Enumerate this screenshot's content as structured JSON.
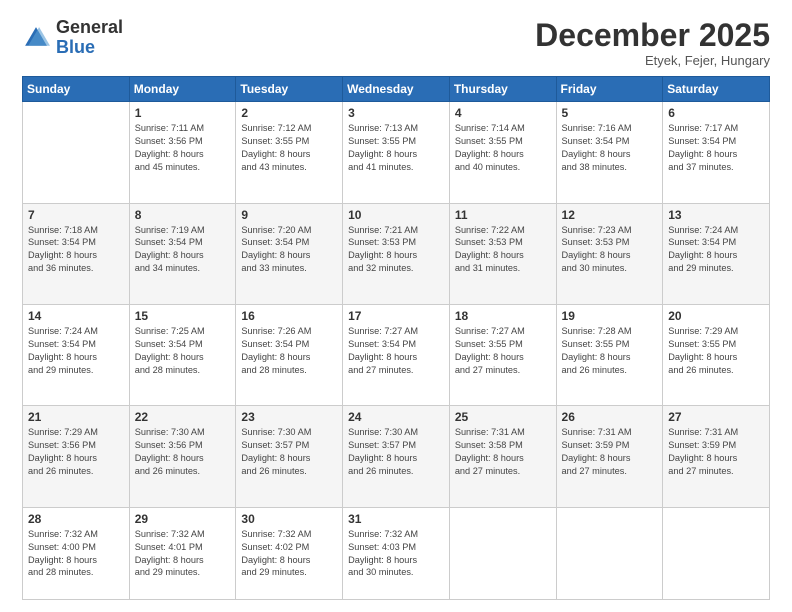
{
  "header": {
    "logo_line1": "General",
    "logo_line2": "Blue",
    "month": "December 2025",
    "location": "Etyek, Fejer, Hungary"
  },
  "days_of_week": [
    "Sunday",
    "Monday",
    "Tuesday",
    "Wednesday",
    "Thursday",
    "Friday",
    "Saturday"
  ],
  "weeks": [
    [
      {
        "day": "",
        "content": ""
      },
      {
        "day": "1",
        "content": "Sunrise: 7:11 AM\nSunset: 3:56 PM\nDaylight: 8 hours\nand 45 minutes."
      },
      {
        "day": "2",
        "content": "Sunrise: 7:12 AM\nSunset: 3:55 PM\nDaylight: 8 hours\nand 43 minutes."
      },
      {
        "day": "3",
        "content": "Sunrise: 7:13 AM\nSunset: 3:55 PM\nDaylight: 8 hours\nand 41 minutes."
      },
      {
        "day": "4",
        "content": "Sunrise: 7:14 AM\nSunset: 3:55 PM\nDaylight: 8 hours\nand 40 minutes."
      },
      {
        "day": "5",
        "content": "Sunrise: 7:16 AM\nSunset: 3:54 PM\nDaylight: 8 hours\nand 38 minutes."
      },
      {
        "day": "6",
        "content": "Sunrise: 7:17 AM\nSunset: 3:54 PM\nDaylight: 8 hours\nand 37 minutes."
      }
    ],
    [
      {
        "day": "7",
        "content": "Sunrise: 7:18 AM\nSunset: 3:54 PM\nDaylight: 8 hours\nand 36 minutes."
      },
      {
        "day": "8",
        "content": "Sunrise: 7:19 AM\nSunset: 3:54 PM\nDaylight: 8 hours\nand 34 minutes."
      },
      {
        "day": "9",
        "content": "Sunrise: 7:20 AM\nSunset: 3:54 PM\nDaylight: 8 hours\nand 33 minutes."
      },
      {
        "day": "10",
        "content": "Sunrise: 7:21 AM\nSunset: 3:53 PM\nDaylight: 8 hours\nand 32 minutes."
      },
      {
        "day": "11",
        "content": "Sunrise: 7:22 AM\nSunset: 3:53 PM\nDaylight: 8 hours\nand 31 minutes."
      },
      {
        "day": "12",
        "content": "Sunrise: 7:23 AM\nSunset: 3:53 PM\nDaylight: 8 hours\nand 30 minutes."
      },
      {
        "day": "13",
        "content": "Sunrise: 7:24 AM\nSunset: 3:54 PM\nDaylight: 8 hours\nand 29 minutes."
      }
    ],
    [
      {
        "day": "14",
        "content": "Sunrise: 7:24 AM\nSunset: 3:54 PM\nDaylight: 8 hours\nand 29 minutes."
      },
      {
        "day": "15",
        "content": "Sunrise: 7:25 AM\nSunset: 3:54 PM\nDaylight: 8 hours\nand 28 minutes."
      },
      {
        "day": "16",
        "content": "Sunrise: 7:26 AM\nSunset: 3:54 PM\nDaylight: 8 hours\nand 28 minutes."
      },
      {
        "day": "17",
        "content": "Sunrise: 7:27 AM\nSunset: 3:54 PM\nDaylight: 8 hours\nand 27 minutes."
      },
      {
        "day": "18",
        "content": "Sunrise: 7:27 AM\nSunset: 3:55 PM\nDaylight: 8 hours\nand 27 minutes."
      },
      {
        "day": "19",
        "content": "Sunrise: 7:28 AM\nSunset: 3:55 PM\nDaylight: 8 hours\nand 26 minutes."
      },
      {
        "day": "20",
        "content": "Sunrise: 7:29 AM\nSunset: 3:55 PM\nDaylight: 8 hours\nand 26 minutes."
      }
    ],
    [
      {
        "day": "21",
        "content": "Sunrise: 7:29 AM\nSunset: 3:56 PM\nDaylight: 8 hours\nand 26 minutes."
      },
      {
        "day": "22",
        "content": "Sunrise: 7:30 AM\nSunset: 3:56 PM\nDaylight: 8 hours\nand 26 minutes."
      },
      {
        "day": "23",
        "content": "Sunrise: 7:30 AM\nSunset: 3:57 PM\nDaylight: 8 hours\nand 26 minutes."
      },
      {
        "day": "24",
        "content": "Sunrise: 7:30 AM\nSunset: 3:57 PM\nDaylight: 8 hours\nand 26 minutes."
      },
      {
        "day": "25",
        "content": "Sunrise: 7:31 AM\nSunset: 3:58 PM\nDaylight: 8 hours\nand 27 minutes."
      },
      {
        "day": "26",
        "content": "Sunrise: 7:31 AM\nSunset: 3:59 PM\nDaylight: 8 hours\nand 27 minutes."
      },
      {
        "day": "27",
        "content": "Sunrise: 7:31 AM\nSunset: 3:59 PM\nDaylight: 8 hours\nand 27 minutes."
      }
    ],
    [
      {
        "day": "28",
        "content": "Sunrise: 7:32 AM\nSunset: 4:00 PM\nDaylight: 8 hours\nand 28 minutes."
      },
      {
        "day": "29",
        "content": "Sunrise: 7:32 AM\nSunset: 4:01 PM\nDaylight: 8 hours\nand 29 minutes."
      },
      {
        "day": "30",
        "content": "Sunrise: 7:32 AM\nSunset: 4:02 PM\nDaylight: 8 hours\nand 29 minutes."
      },
      {
        "day": "31",
        "content": "Sunrise: 7:32 AM\nSunset: 4:03 PM\nDaylight: 8 hours\nand 30 minutes."
      },
      {
        "day": "",
        "content": ""
      },
      {
        "day": "",
        "content": ""
      },
      {
        "day": "",
        "content": ""
      }
    ]
  ]
}
